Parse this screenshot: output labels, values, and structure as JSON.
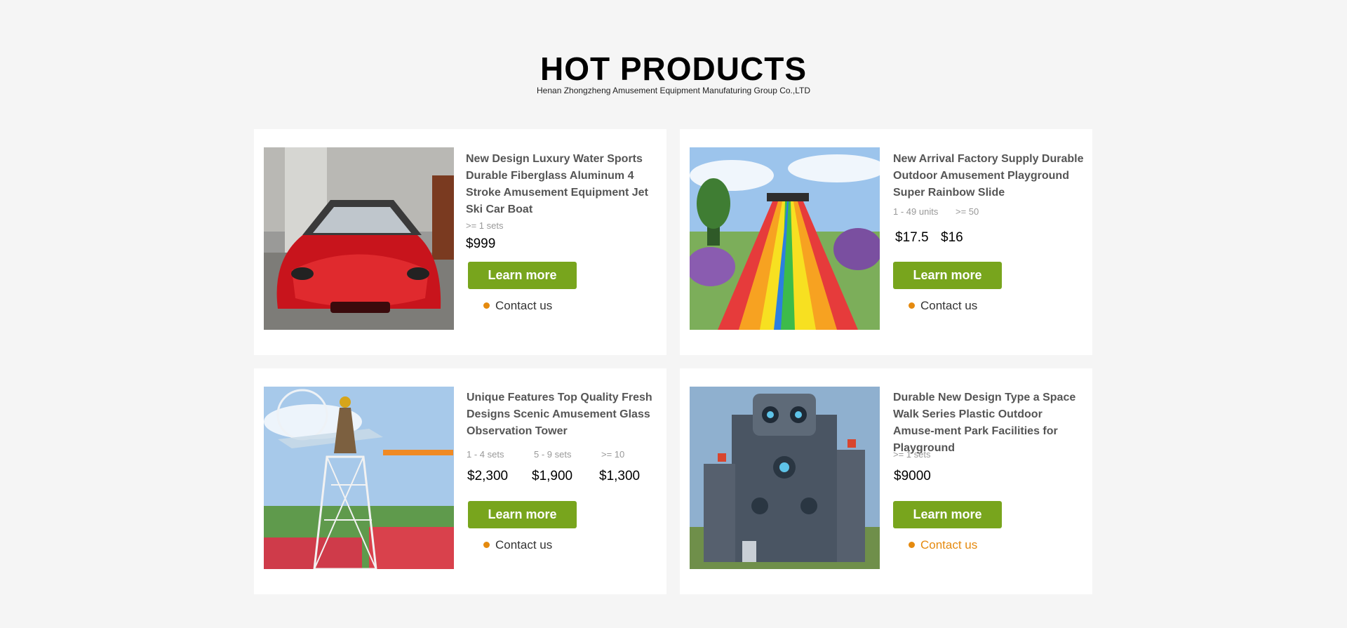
{
  "section": {
    "title": "HOT PRODUCTS",
    "subtitle": "Henan Zhongzheng Amusement Equipment Manufaturing Group Co.,LTD"
  },
  "products": [
    {
      "title": "New Design Luxury Water Sports Durable Fiberglass Aluminum 4 Stroke Amusement Equipment Jet Ski Car Boat",
      "tiers": [
        ">= 1 sets"
      ],
      "prices": [
        "$999"
      ],
      "learn_label": "Learn more",
      "contact_label": "Contact us",
      "image_icon": "red-sports-car-photo"
    },
    {
      "title": "New Arrival Factory Supply Durable Outdoor Amusement Playground Super Rainbow Slide",
      "tiers": [
        "1 - 49 units",
        ">= 50"
      ],
      "prices": [
        "$17.5",
        "$16"
      ],
      "learn_label": "Learn more",
      "contact_label": "Contact us",
      "image_icon": "rainbow-slide-photo"
    },
    {
      "title": "Unique Features Top Quality Fresh Designs Scenic Amusement Glass Observation Tower",
      "tiers": [
        "1 - 4 sets",
        "5 - 9 sets",
        ">= 10"
      ],
      "prices": [
        "$2,300",
        "$1,900",
        "$1,300"
      ],
      "learn_label": "Learn more",
      "contact_label": "Contact us",
      "image_icon": "observation-tower-photo"
    },
    {
      "title": "Durable New Design Type a Space Walk Series Plastic Outdoor Amuse-ment Park Facilities for Playground",
      "tiers": [
        ">= 1 sets"
      ],
      "prices": [
        "$9000"
      ],
      "learn_label": "Learn more",
      "contact_label": "Contact us",
      "image_icon": "robot-playground-photo"
    }
  ],
  "colors": {
    "accent_green": "#78a51d",
    "contact_orange": "#e58a0f",
    "page_background": "#f5f5f5"
  }
}
